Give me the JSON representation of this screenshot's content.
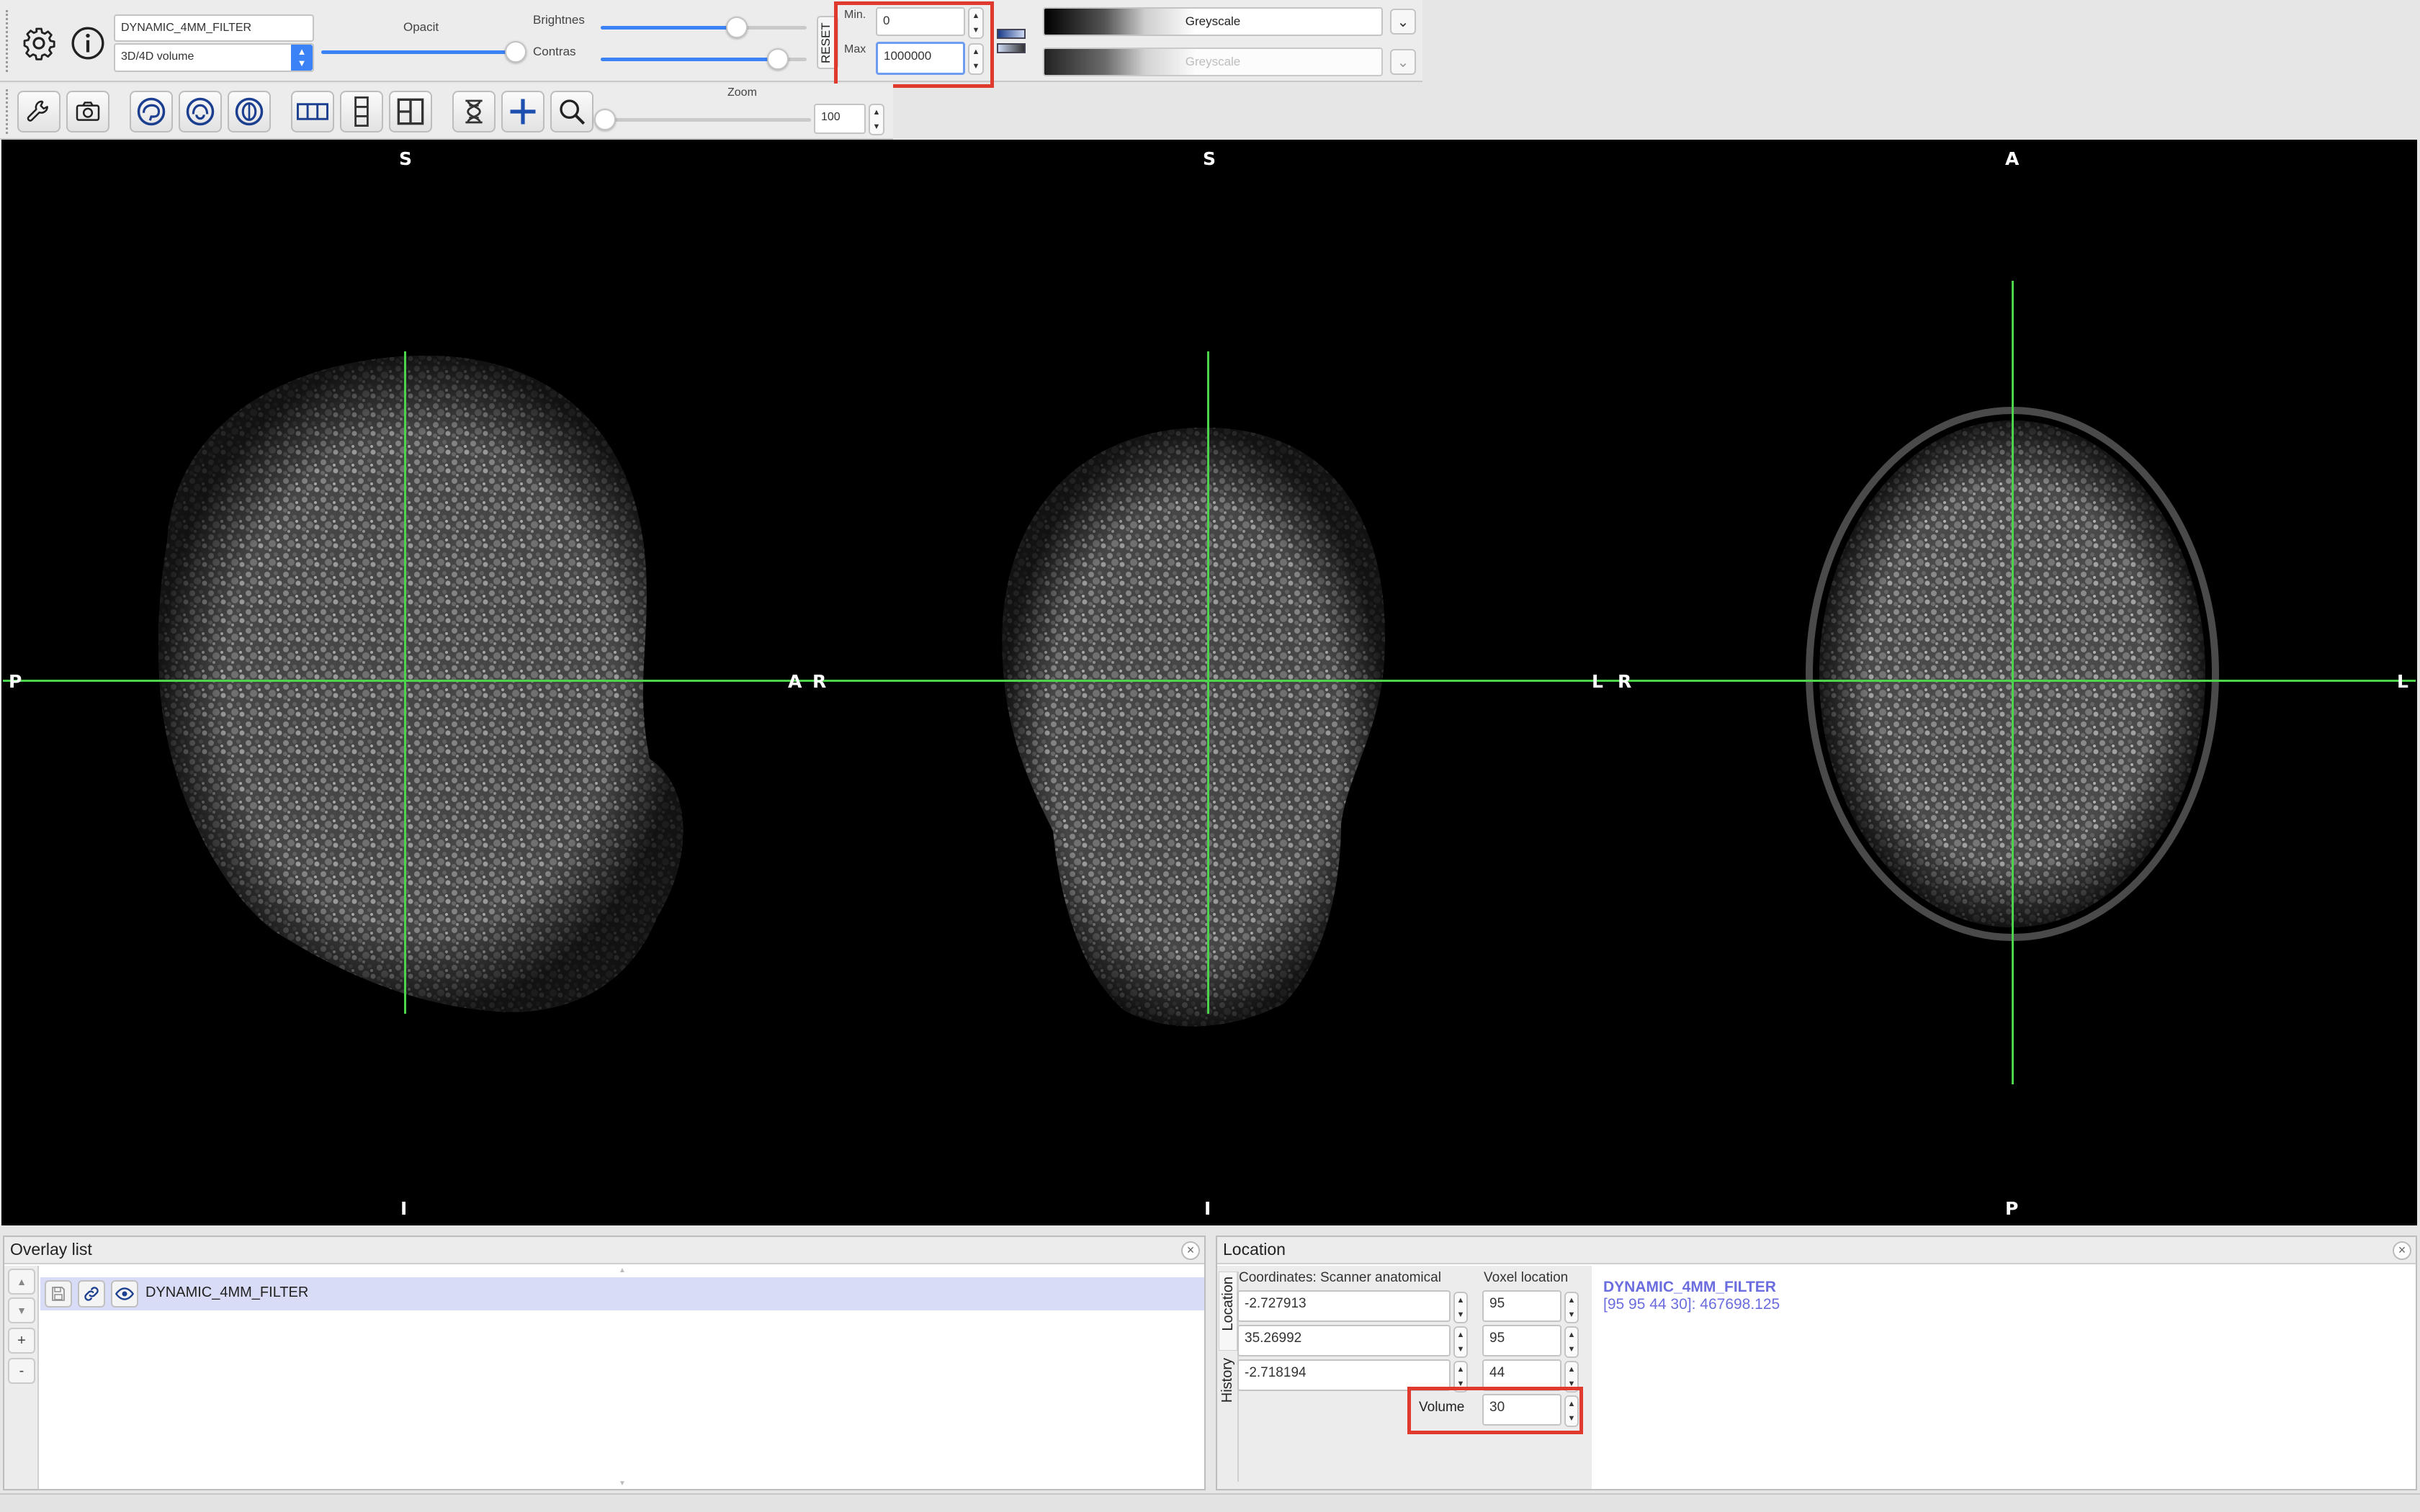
{
  "toolbar": {
    "overlay_name": "DYNAMIC_4MM_FILTER",
    "volume_type": "3D/4D volume",
    "opacity_label": "Opacit",
    "brightness_label": "Brightnes",
    "contrast_label": "Contras",
    "reset_label": "RESET",
    "min_label": "Min.",
    "min_value": "0",
    "max_label": "Max",
    "max_value": "1000000",
    "cmap_primary": "Greyscale",
    "cmap_secondary": "Greyscale",
    "opacity_fraction": 1.0,
    "brightness_fraction": 0.66,
    "contrast_fraction": 0.86,
    "zoom_label": "Zoom",
    "zoom_value": "100",
    "zoom_fraction": 0.0
  },
  "viewer": {
    "sagittal": {
      "top": "S",
      "bottom": "I",
      "left": "P",
      "right": "A"
    },
    "coronal": {
      "top": "S",
      "bottom": "I",
      "left": "R",
      "right": "L"
    },
    "axial": {
      "top": "A",
      "bottom": "P",
      "left": "R",
      "right": "L"
    },
    "crosshair_color": "#4cd44c"
  },
  "overlay_list": {
    "title": "Overlay list",
    "items": [
      {
        "name": "DYNAMIC_4MM_FILTER"
      }
    ],
    "add_label": "+",
    "remove_label": "-",
    "up_label": "▲",
    "down_label": "▼"
  },
  "location": {
    "title": "Location",
    "tab_location": "Location",
    "tab_history": "History",
    "coords_label": "Coordinates: Scanner anatomical",
    "voxel_label": "Voxel location",
    "coords": [
      "-2.727913",
      "35.26992",
      "-2.718194"
    ],
    "voxels": [
      "95",
      "95",
      "44"
    ],
    "volume_label": "Volume",
    "volume_value": "30",
    "info_name": "DYNAMIC_4MM_FILTER",
    "info_value": "[95 95 44 30]: 467698.125",
    "info_color": "#6b6ddf"
  }
}
